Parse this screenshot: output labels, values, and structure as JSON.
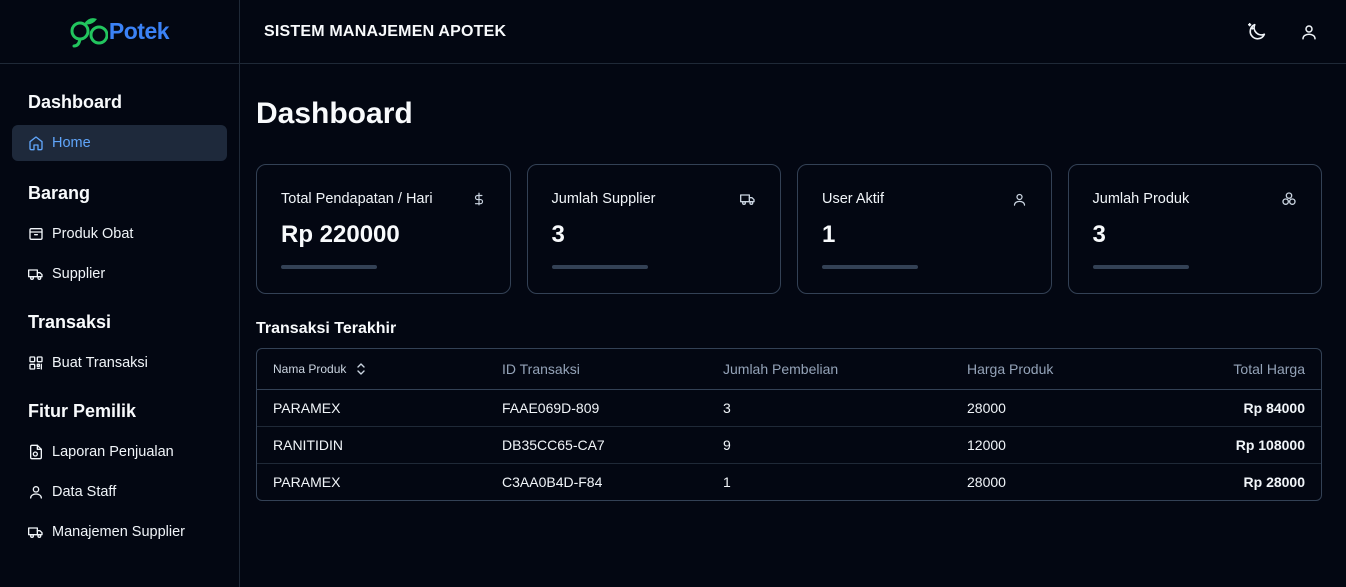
{
  "brand": {
    "name": "Potek",
    "accent": "#3b82f6",
    "leaf_color": "#22c55e"
  },
  "header": {
    "title": "SISTEM MANAJEMEN APOTEK",
    "icons": [
      "theme-toggle-icon",
      "user-icon"
    ]
  },
  "sidebar": {
    "sections": [
      {
        "heading": "Dashboard",
        "items": [
          {
            "label": "Home",
            "icon": "home-icon",
            "active": true
          }
        ]
      },
      {
        "heading": "Barang",
        "items": [
          {
            "label": "Produk Obat",
            "icon": "box-icon"
          },
          {
            "label": "Supplier",
            "icon": "truck-icon"
          }
        ]
      },
      {
        "heading": "Transaksi",
        "items": [
          {
            "label": "Buat Transaksi",
            "icon": "scan-icon"
          }
        ]
      },
      {
        "heading": "Fitur Pemilik",
        "items": [
          {
            "label": "Laporan Penjualan",
            "icon": "report-icon"
          },
          {
            "label": "Data Staff",
            "icon": "user-icon"
          },
          {
            "label": "Manajemen Supplier",
            "icon": "truck-icon"
          }
        ]
      }
    ]
  },
  "main": {
    "title": "Dashboard",
    "cards": [
      {
        "label": "Total Pendapatan / Hari",
        "value": "Rp 220000",
        "icon": "dollar-icon"
      },
      {
        "label": "Jumlah Supplier",
        "value": "3",
        "icon": "truck-icon"
      },
      {
        "label": "User Aktif",
        "value": "1",
        "icon": "user-icon"
      },
      {
        "label": "Jumlah Produk",
        "value": "3",
        "icon": "boxes-icon"
      }
    ],
    "recent": {
      "title": "Transaksi Terakhir",
      "columns": [
        "Nama Produk",
        "ID Transaksi",
        "Jumlah Pembelian",
        "Harga Produk",
        "Total Harga"
      ],
      "rows": [
        [
          "PARAMEX",
          "FAAE069D-809",
          "3",
          "28000",
          "Rp 84000"
        ],
        [
          "RANITIDIN",
          "DB35CC65-CA7",
          "9",
          "12000",
          "Rp 108000"
        ],
        [
          "PARAMEX",
          "C3AA0B4D-F84",
          "1",
          "28000",
          "Rp 28000"
        ]
      ]
    }
  }
}
